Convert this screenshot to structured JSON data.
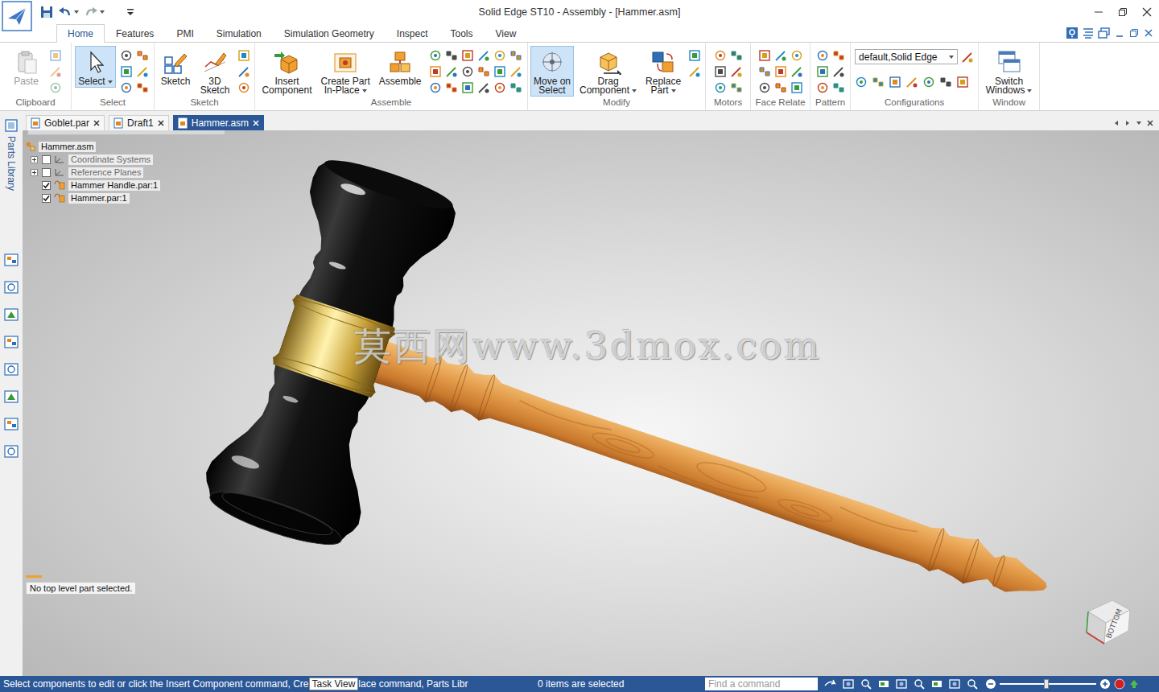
{
  "window": {
    "title": "Solid Edge ST10 - Assembly - [Hammer.asm]"
  },
  "ribbon_tabs": [
    {
      "label": "Home",
      "selected": true
    },
    {
      "label": "Features",
      "selected": false
    },
    {
      "label": "PMI",
      "selected": false
    },
    {
      "label": "Simulation",
      "selected": false
    },
    {
      "label": "Simulation Geometry",
      "selected": false
    },
    {
      "label": "Inspect",
      "selected": false
    },
    {
      "label": "Tools",
      "selected": false
    },
    {
      "label": "View",
      "selected": false
    }
  ],
  "ribbon_groups": [
    {
      "label": "Clipboard",
      "buttons": [
        {
          "label": [
            "Paste"
          ],
          "disabled": true,
          "selected": false,
          "dropdown": false
        }
      ]
    },
    {
      "label": "Select",
      "buttons": [
        {
          "label": [
            "Select"
          ],
          "disabled": false,
          "selected": true,
          "dropdown": true
        }
      ]
    },
    {
      "label": "Sketch",
      "buttons": [
        {
          "label": [
            "Sketch"
          ],
          "disabled": false,
          "selected": false,
          "dropdown": false
        },
        {
          "label": [
            "3D",
            "Sketch"
          ],
          "disabled": false,
          "selected": false,
          "dropdown": false
        }
      ]
    },
    {
      "label": "Assemble",
      "buttons": [
        {
          "label": [
            "Insert",
            "Component"
          ],
          "disabled": false,
          "selected": false,
          "dropdown": false
        },
        {
          "label": [
            "Create Part",
            "In-Place"
          ],
          "disabled": false,
          "selected": false,
          "dropdown": true
        },
        {
          "label": [
            "Assemble"
          ],
          "disabled": false,
          "selected": false,
          "dropdown": false
        }
      ]
    },
    {
      "label": "Modify",
      "buttons": [
        {
          "label": [
            "Move on",
            "Select"
          ],
          "disabled": false,
          "selected": true,
          "dropdown": false
        },
        {
          "label": [
            "Drag",
            "Component"
          ],
          "disabled": false,
          "selected": false,
          "dropdown": true
        },
        {
          "label": [
            "Replace",
            "Part"
          ],
          "disabled": false,
          "selected": false,
          "dropdown": true
        }
      ]
    },
    {
      "label": "Motors",
      "buttons": []
    },
    {
      "label": "Face Relate",
      "buttons": []
    },
    {
      "label": "Pattern",
      "buttons": []
    },
    {
      "label": "Configurations",
      "buttons": [],
      "dropdown_value": "default,Solid Edge"
    },
    {
      "label": "Window",
      "buttons": [
        {
          "label": [
            "Switch",
            "Windows"
          ],
          "disabled": false,
          "selected": false,
          "dropdown": true
        }
      ]
    }
  ],
  "doc_tabs": [
    {
      "label": "Goblet.par",
      "selected": false
    },
    {
      "label": "Draft1",
      "selected": false
    },
    {
      "label": "Hammer.asm",
      "selected": true
    }
  ],
  "left_strip": {
    "label": "Parts Library"
  },
  "tree": {
    "root": "Hammer.asm",
    "items": [
      {
        "label": "Coordinate Systems",
        "checked": false,
        "expandable": true,
        "expanded": false,
        "greyed": true
      },
      {
        "label": "Reference Planes",
        "checked": false,
        "expandable": true,
        "expanded": false,
        "greyed": true
      },
      {
        "label": "Hammer Handle.par:1",
        "checked": true,
        "expandable": false,
        "expanded": false,
        "greyed": false
      },
      {
        "label": "Hammer.par:1",
        "checked": true,
        "expandable": false,
        "expanded": false,
        "greyed": false
      }
    ]
  },
  "viewport": {
    "watermark": "莫西网www.3dmox.com",
    "message": "No top level part selected.",
    "view_cube": "BOTTOM"
  },
  "status": {
    "prompt_left": "Select components to edit or click the Insert Component command, Cre",
    "tooltip": "Task View",
    "prompt_right": "lace command, Parts Libr",
    "selection": "0 items are selected",
    "search_placeholder": "Find a command",
    "zoom_level": 0.48
  }
}
